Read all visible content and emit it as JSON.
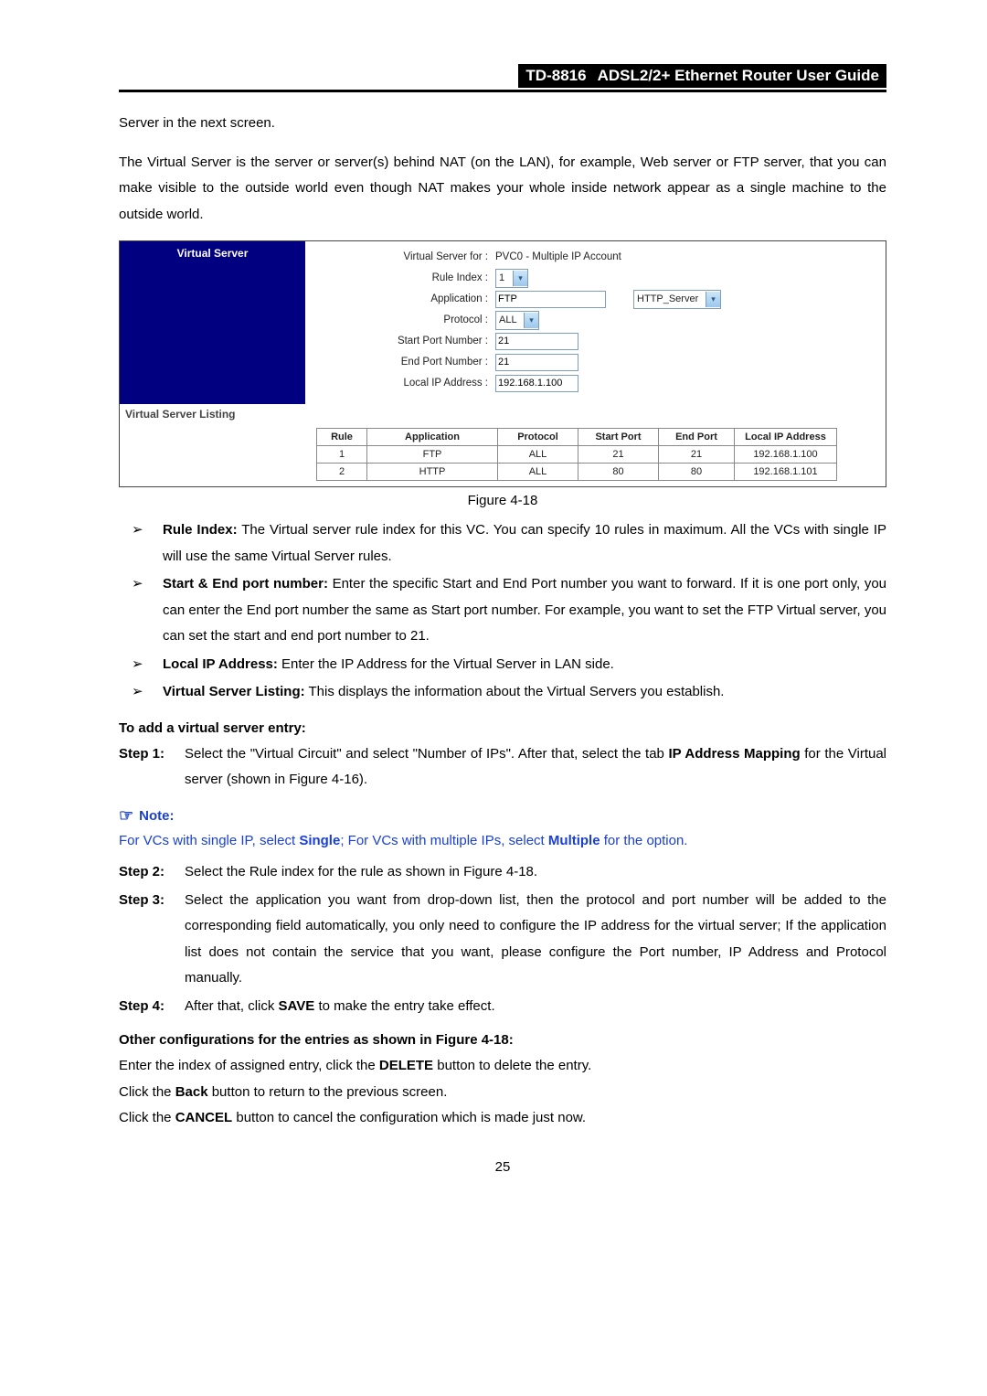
{
  "header": {
    "model": "TD-8816",
    "title": "ADSL2/2+ Ethernet Router User Guide"
  },
  "intro1": "Server in the next screen.",
  "intro2": "The Virtual Server is the server or server(s) behind NAT (on the LAN), for example, Web server or FTP server, that you can make visible to the outside world even though NAT makes your whole inside network appear as a single machine to the outside world.",
  "vs": {
    "panel_title": "Virtual Server",
    "for_label": "Virtual Server for :",
    "for_value": "PVC0 - Multiple IP Account",
    "rule_index_label": "Rule Index :",
    "rule_index_value": "1",
    "application_label": "Application :",
    "application_value": "FTP",
    "app_preset_value": "HTTP_Server",
    "protocol_label": "Protocol :",
    "protocol_value": "ALL",
    "start_port_label": "Start Port Number :",
    "start_port_value": "21",
    "end_port_label": "End Port Number :",
    "end_port_value": "21",
    "local_ip_label": "Local IP Address :",
    "local_ip_value": "192.168.1.100",
    "listing_title": "Virtual Server Listing"
  },
  "chart_data": {
    "type": "table",
    "title": "Virtual Server Listing",
    "headers": [
      "Rule",
      "Application",
      "Protocol",
      "Start Port",
      "End Port",
      "Local IP Address"
    ],
    "rows": [
      [
        "1",
        "FTP",
        "ALL",
        "21",
        "21",
        "192.168.1.100"
      ],
      [
        "2",
        "HTTP",
        "ALL",
        "80",
        "80",
        "192.168.1.101"
      ]
    ]
  },
  "figure_caption": "Figure 4-18",
  "bullets": {
    "b1_label": "Rule Index:",
    "b1_text": " The Virtual server rule index for this VC. You can specify 10 rules in maximum. All the VCs with single IP will use the same Virtual Server rules.",
    "b2_label": "Start & End port number:",
    "b2_text": " Enter the specific Start and End Port number you want to forward. If it is one port only, you can enter the End port number the same as Start port number. For example, you want to set the FTP Virtual server, you can set the start and end port number to 21.",
    "b3_label": "Local IP Address:",
    "b3_text": " Enter the IP Address for the Virtual Server in LAN side.",
    "b4_label": "Virtual Server Listing:",
    "b4_text": " This displays the information about the Virtual Servers you establish."
  },
  "add_heading": "To add a virtual server entry:",
  "steps": {
    "s1_tag": "Step 1:",
    "s1_a": "Select the \"Virtual Circuit\" and select \"Number of IPs\". After that, select the tab ",
    "s1_b": "IP Address Mapping",
    "s1_c": " for the Virtual server (shown in Figure 4-16).",
    "s2_tag": "Step 2:",
    "s2": "Select the Rule index for the rule as shown in Figure 4-18.",
    "s3_tag": "Step 3:",
    "s3": "Select the application you want from drop-down list, then the protocol and port number will be added to the corresponding field automatically, you only need to configure the IP address for the virtual server; If the application list does not contain the service that you want, please configure the Port number, IP Address and Protocol manually.",
    "s4_tag": "Step 4:",
    "s4_a": "After that, click ",
    "s4_b": "SAVE",
    "s4_c": " to make the entry take effect."
  },
  "note": {
    "label": "Note:",
    "body_a": "For VCs with single IP, select ",
    "body_b": "Single",
    "body_c": "; For VCs with multiple IPs, select ",
    "body_d": "Multiple",
    "body_e": " for the option."
  },
  "other_heading": "Other configurations for the entries as shown in Figure 4-18:",
  "other1_a": "Enter the index of assigned entry, click the ",
  "other1_b": "DELETE",
  "other1_c": " button to delete the entry.",
  "other2_a": "Click the ",
  "other2_b": "Back",
  "other2_c": " button to return to the previous screen.",
  "other3_a": "Click the ",
  "other3_b": "CANCEL",
  "other3_c": " button to cancel the configuration which is made just now.",
  "page_number": "25"
}
